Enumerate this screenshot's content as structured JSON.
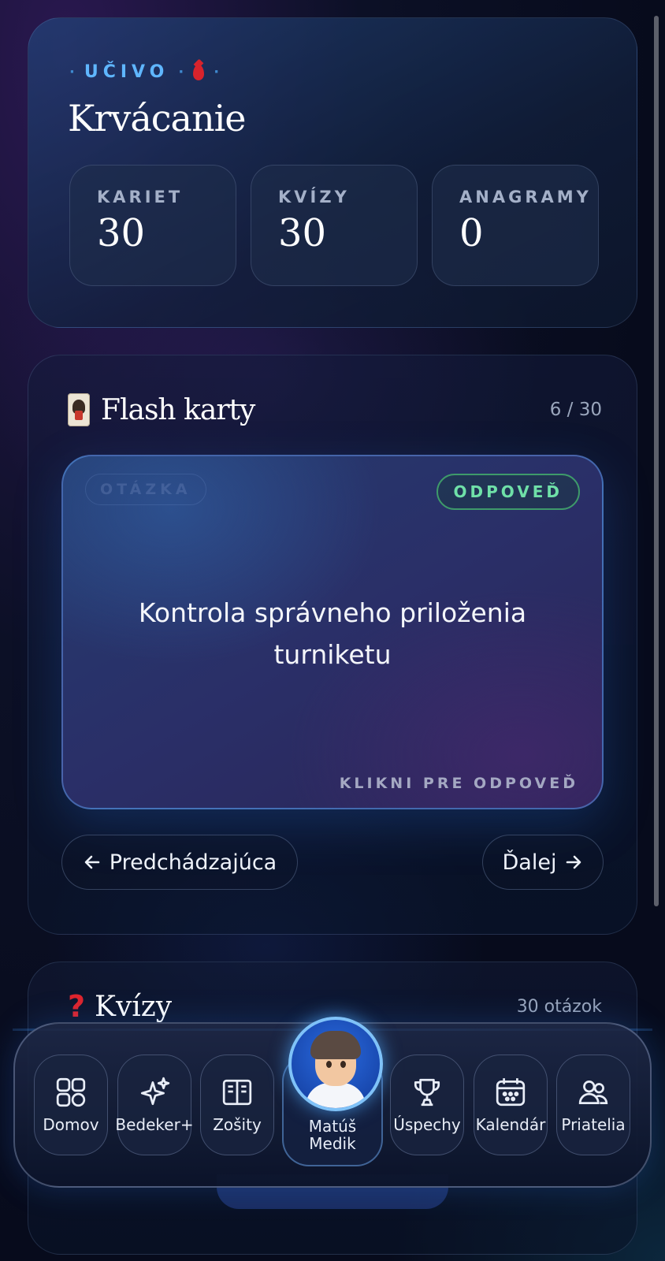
{
  "hero": {
    "eyebrow": "UČIVO",
    "title": "Krvácanie",
    "stats": [
      {
        "label": "KARIET",
        "value": "30"
      },
      {
        "label": "KVÍZY",
        "value": "30"
      },
      {
        "label": "ANAGRAMY",
        "value": "0"
      }
    ]
  },
  "flashcards": {
    "title": "Flash karty",
    "counter": "6 / 30",
    "chip_question": "OTÁZKA",
    "chip_answer": "ODPOVEĎ",
    "text": "Kontrola správneho priloženia turniketu",
    "hint": "KLIKNI PRE ODPOVEĎ",
    "prev_label": "Predchádzajúca",
    "next_label": "Ďalej"
  },
  "quiz": {
    "title": "Kvízy",
    "count": "30 otázok"
  },
  "dock": {
    "items": [
      {
        "label": "Domov",
        "icon": "home-grid-icon"
      },
      {
        "label": "Bedeker+",
        "icon": "sparkle-icon"
      },
      {
        "label": "Zošity",
        "icon": "book-icon"
      },
      {
        "label": "Úspechy",
        "icon": "trophy-icon"
      },
      {
        "label": "Kalendár",
        "icon": "calendar-icon"
      },
      {
        "label": "Priatelia",
        "icon": "friends-icon"
      }
    ],
    "profile_line1": "Matúš",
    "profile_line2": "Medik"
  },
  "colors": {
    "accent_blue": "#5fb6ff",
    "answer_green": "#6fe0a8",
    "drop_red": "#d8232c"
  }
}
